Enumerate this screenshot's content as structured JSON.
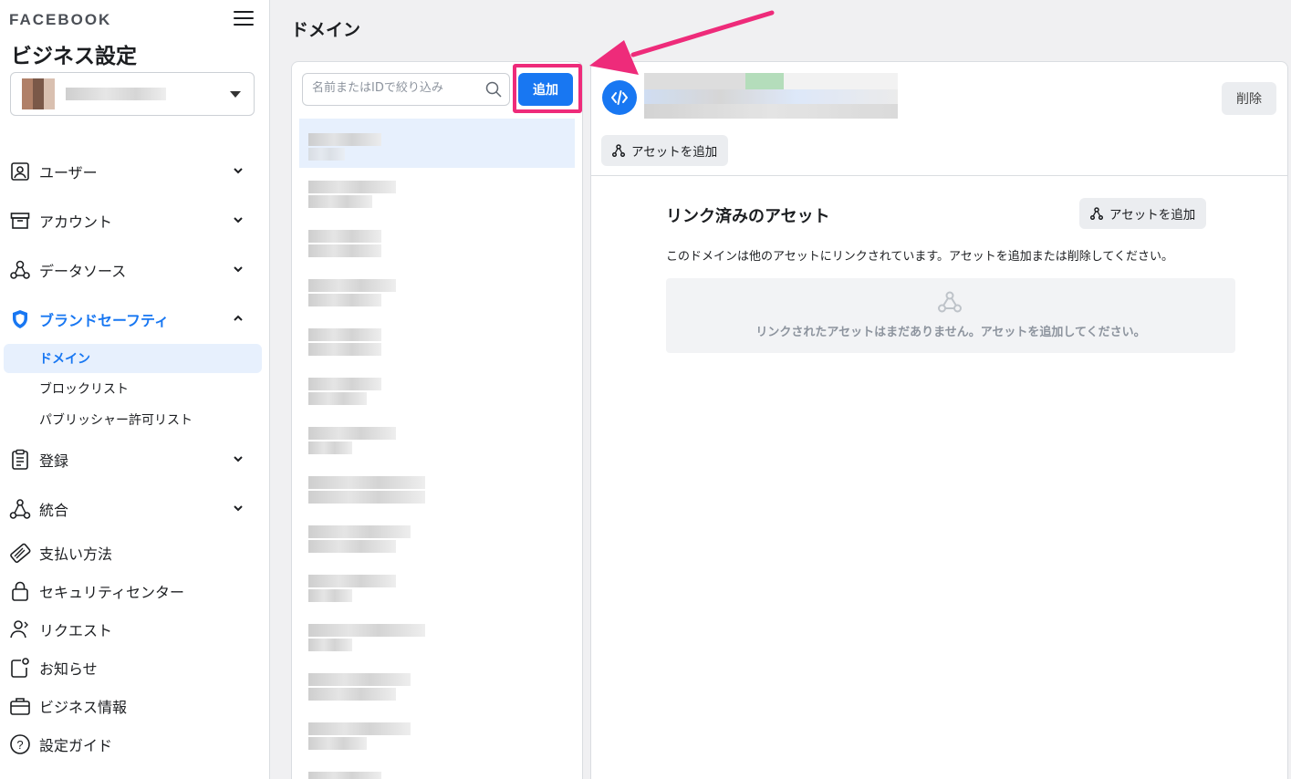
{
  "sidebar": {
    "brand": "FACEBOOK",
    "title": "ビジネス設定",
    "nav": [
      {
        "label": "ユーザー",
        "icon": "user-card-icon"
      },
      {
        "label": "アカウント",
        "icon": "archive-box-icon"
      },
      {
        "label": "データソース",
        "icon": "data-sources-icon"
      },
      {
        "label": "ブランドセーフティ",
        "icon": "shield-icon"
      },
      {
        "label": "登録",
        "icon": "clipboard-icon"
      },
      {
        "label": "統合",
        "icon": "integrations-icon"
      },
      {
        "label": "支払い方法",
        "icon": "credit-card-icon"
      },
      {
        "label": "セキュリティセンター",
        "icon": "lock-icon"
      },
      {
        "label": "リクエスト",
        "icon": "person-request-icon"
      },
      {
        "label": "お知らせ",
        "icon": "notification-icon"
      },
      {
        "label": "ビジネス情報",
        "icon": "briefcase-icon"
      },
      {
        "label": "設定ガイド",
        "icon": "question-icon"
      }
    ],
    "brand_safety_sub": [
      {
        "label": "ドメイン",
        "active": true
      },
      {
        "label": "ブロックリスト"
      },
      {
        "label": "パブリッシャー許可リスト"
      }
    ]
  },
  "main": {
    "page_title": "ドメイン",
    "search_placeholder": "名前またはIDで絞り込み",
    "add_label": "追加",
    "delete_label": "削除",
    "add_asset_label": "アセットを追加",
    "linked_assets_title": "リンク済みのアセット",
    "linked_assets_desc": "このドメインは他のアセットにリンクされています。アセットを追加または削除してください。",
    "empty_text": "リンクされたアセットはまだありません。アセットを追加してください。"
  },
  "colors": {
    "accent": "#1877f2",
    "highlight": "#ee2b7a"
  }
}
